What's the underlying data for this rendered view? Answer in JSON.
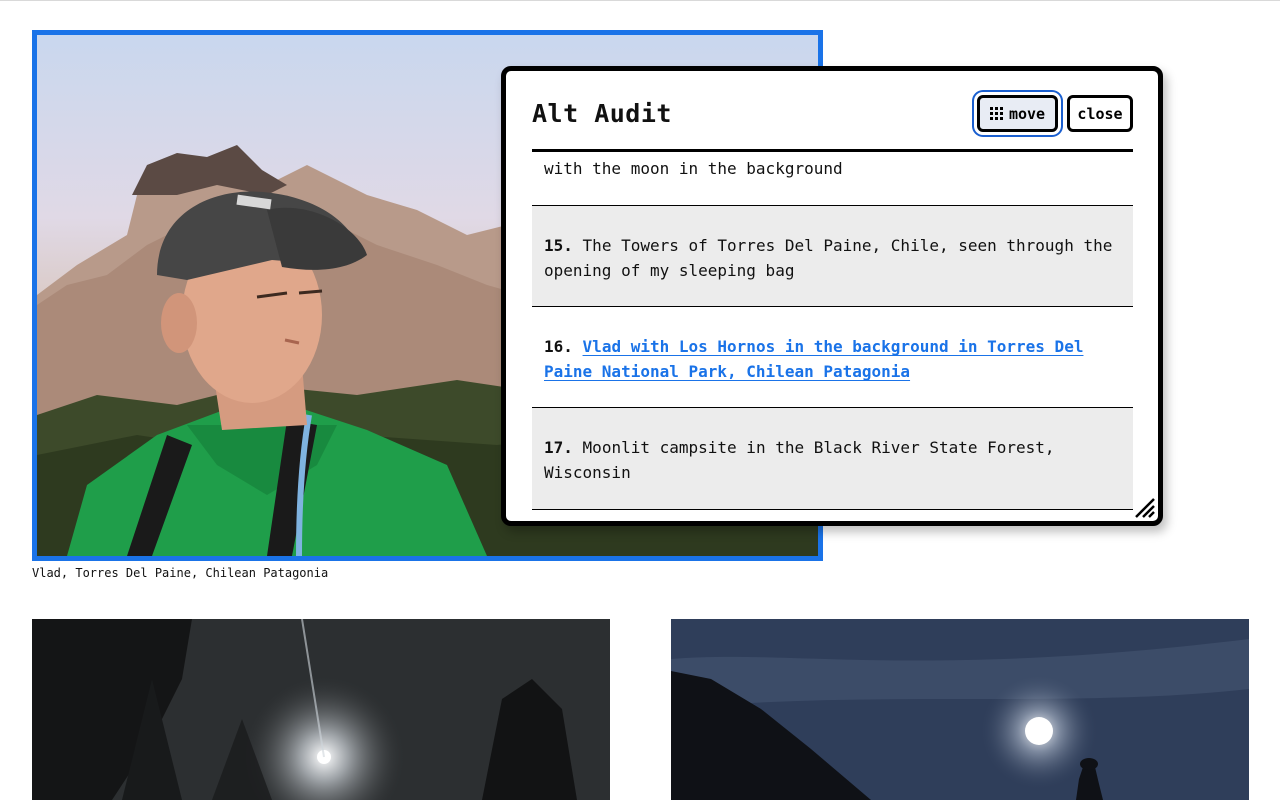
{
  "featured": {
    "caption": "Vlad, Torres Del Paine, Chilean Patagonia"
  },
  "panel": {
    "title": "Alt Audit",
    "move_label": "move",
    "close_label": "close",
    "items": [
      {
        "number": "",
        "text": "with the moon in the background"
      },
      {
        "number": "15.",
        "text": "The Towers of Torres Del Paine, Chile, seen through the opening of my sleeping bag"
      },
      {
        "number": "16.",
        "text": "Vlad with Los Hornos in the background in Torres Del Paine National Park, Chilean Patagonia"
      },
      {
        "number": "17.",
        "text": "Moonlit campsite in the Black River State Forest, Wisconsin"
      }
    ]
  },
  "colors": {
    "accent": "#1a73e8",
    "panel_border": "#000000",
    "item_gray": "#ececec"
  },
  "icons": {
    "move": "grip-dots-icon",
    "resize": "resize-handle-icon"
  }
}
